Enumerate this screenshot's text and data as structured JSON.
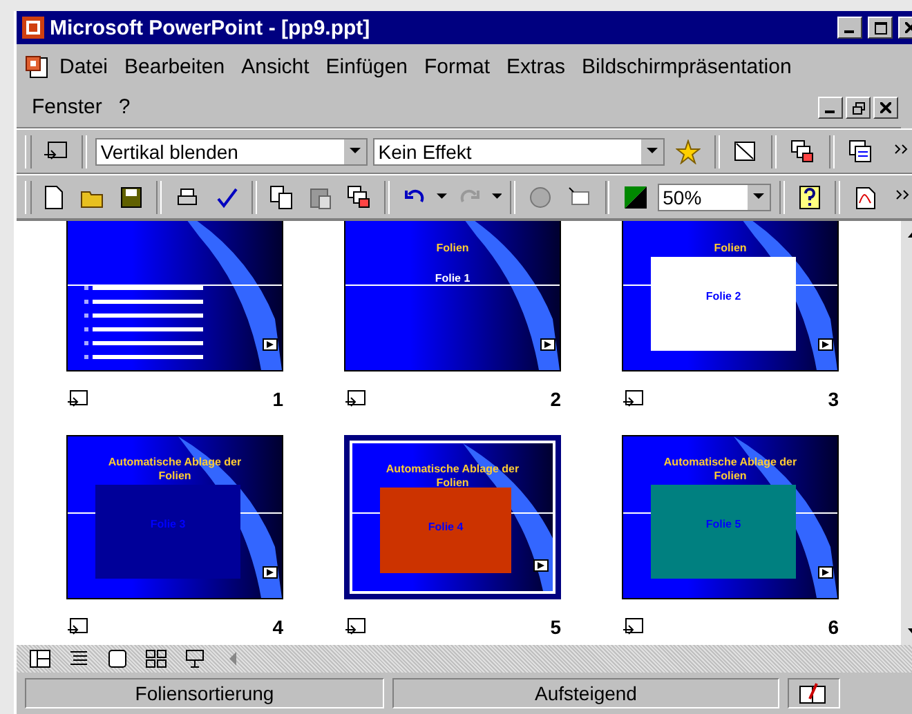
{
  "window": {
    "title": "Microsoft PowerPoint - [pp9.ppt]"
  },
  "menu": [
    {
      "label": "Datei"
    },
    {
      "label": "Bearbeiten"
    },
    {
      "label": "Ansicht"
    },
    {
      "label": "Einfügen"
    },
    {
      "label": "Format"
    },
    {
      "label": "Extras"
    },
    {
      "label": "Bildschirmpräsentation"
    },
    {
      "label": "Fenster"
    },
    {
      "label": "?"
    }
  ],
  "transition": {
    "value": "Vertikal blenden"
  },
  "effect": {
    "value": "Kein Effekt"
  },
  "zoom": {
    "value": "50%"
  },
  "slides": [
    {
      "number": "1",
      "selected": false,
      "kind": "bullets"
    },
    {
      "number": "2",
      "selected": false,
      "kind": "title",
      "title": "Folien",
      "label": "Folie 1"
    },
    {
      "number": "3",
      "selected": false,
      "kind": "box",
      "title": "Folien",
      "label": "Folie 2",
      "color": "#ffffff"
    },
    {
      "number": "4",
      "selected": false,
      "kind": "box",
      "title": "Automatische Ablage der Folien",
      "label": "Folie 3",
      "color": "#000099"
    },
    {
      "number": "5",
      "selected": true,
      "kind": "box",
      "title": "Automatische Ablage der Folien",
      "label": "Folie 4",
      "color": "#cc3300"
    },
    {
      "number": "6",
      "selected": false,
      "kind": "box",
      "title": "Automatische Ablage der Folien",
      "label": "Folie 5",
      "color": "#008080"
    }
  ],
  "status_bar": [
    "Foliensortierung",
    "Aufsteigend"
  ]
}
